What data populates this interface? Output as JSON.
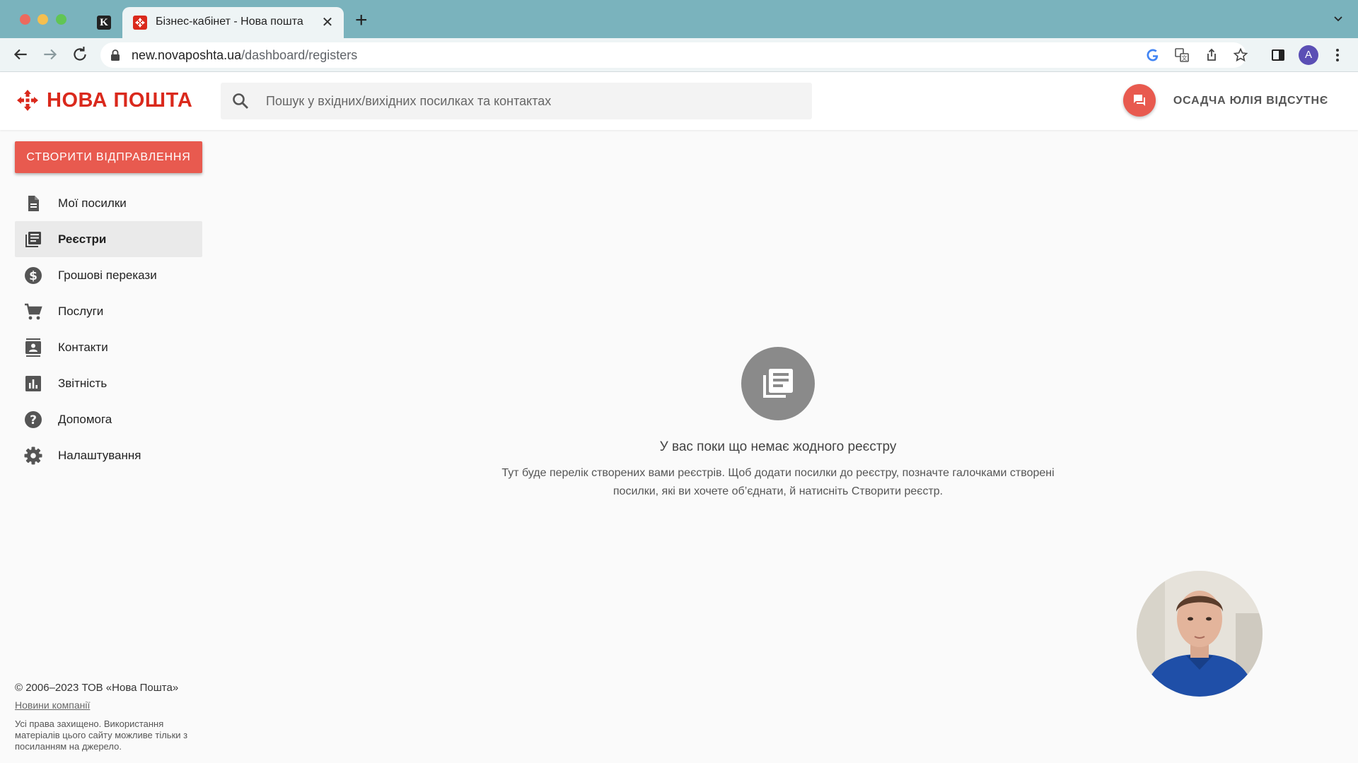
{
  "browser": {
    "active_tab_title": "Бізнес-кабінет - Нова пошта",
    "pinned_tab_letter": "K",
    "url_host": "new.novaposhta.ua",
    "url_path": "/dashboard/registers",
    "profile_initial": "A"
  },
  "header": {
    "logo_text": "НОВА ПОШТА",
    "search_placeholder": "Пошук у вхідних/вихідних посилках та контактах",
    "user_name": "ОСАДЧА ЮЛІЯ ВІДСУТНЄ"
  },
  "sidebar": {
    "create_button": "СТВОРИТИ ВІДПРАВЛЕННЯ",
    "items": [
      {
        "label": "Мої посилки",
        "icon": "document-icon"
      },
      {
        "label": "Реєстри",
        "icon": "registers-icon",
        "active": true
      },
      {
        "label": "Грошові перекази",
        "icon": "dollar-icon"
      },
      {
        "label": "Послуги",
        "icon": "cart-icon"
      },
      {
        "label": "Контакти",
        "icon": "contacts-icon"
      },
      {
        "label": "Звітність",
        "icon": "bar-chart-icon"
      },
      {
        "label": "Допомога",
        "icon": "help-icon"
      },
      {
        "label": "Налаштування",
        "icon": "gear-icon"
      }
    ]
  },
  "main": {
    "empty_title": "У вас поки що немає жодного реєстру",
    "empty_description": "Тут буде перелік створених вами реєстрів. Щоб додати посилки до реєстру, позначте галочками створені посилки, які ви хочете об’єднати, й натисніть Створити реєстр."
  },
  "footer": {
    "copyright": "© 2006–2023 ТОВ «Нова Пошта»",
    "news_link": "Новини компанії",
    "rights": "Усі права захищено. Використання матеріалів цього сайту можливе тільки з посиланням на джерело."
  },
  "colors": {
    "brand_red": "#da291c",
    "accent_red": "#e85a4f",
    "tab_bar": "#7ab3bd"
  }
}
